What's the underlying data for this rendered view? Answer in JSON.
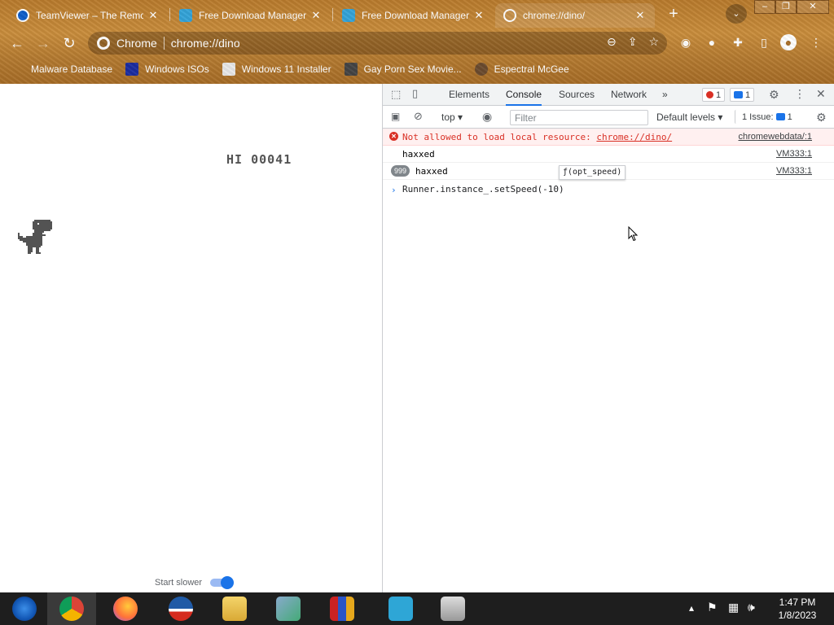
{
  "browser": {
    "tabs": [
      {
        "title": "TeamViewer – The Remote",
        "icon": "teamviewer-icon"
      },
      {
        "title": "Free Download Manager –",
        "icon": "fdm-icon"
      },
      {
        "title": "Free Download Manager –",
        "icon": "fdm-icon"
      },
      {
        "title": "chrome://dino/",
        "icon": "globe-icon",
        "active": true
      }
    ],
    "omnibox": {
      "site": "Chrome",
      "url": "chrome://dino"
    },
    "bookmarks": [
      {
        "label": "Malware Database"
      },
      {
        "label": "Windows ISOs"
      },
      {
        "label": "Windows 11 Installer"
      },
      {
        "label": "Gay Porn Sex Movie..."
      },
      {
        "label": "Espectral McGee"
      }
    ]
  },
  "page": {
    "hi_score": "HI 00041",
    "start_slower_label": "Start slower",
    "start_slower_enabled": true
  },
  "devtools": {
    "tabs": [
      "Elements",
      "Console",
      "Sources",
      "Network"
    ],
    "active_tab": "Console",
    "more_tabs": "»",
    "error_count": "1",
    "message_count": "1",
    "context": "top",
    "filter_placeholder": "Filter",
    "levels": "Default levels",
    "issues": "1 Issue:",
    "issues_count": "1",
    "console": [
      {
        "type": "error",
        "text_prefix": "Not allowed to load local resource: ",
        "link": "chrome://dino/",
        "source": "chromewebdata/:1"
      },
      {
        "type": "log",
        "text": "haxxed",
        "source": "VM333:1"
      },
      {
        "type": "log",
        "repeat": "999",
        "text": "haxxed",
        "source": "VM333:1"
      }
    ],
    "input": "Runner.instance_.setSpeed(-10)",
    "tooltip": "ƒ(opt_speed)"
  },
  "taskbar": {
    "apps": [
      "windows-start-icon",
      "chrome-icon",
      "firefox-icon",
      "obama-icon",
      "file-explorer-icon",
      "network-wizard-icon",
      "winrar-icon",
      "free-download-manager-icon",
      "installer-icon"
    ],
    "time": "1:47 PM",
    "date": "1/8/2023"
  },
  "colors": {
    "accent": "#1a73e8",
    "error": "#d93025",
    "dino": "#535353"
  }
}
